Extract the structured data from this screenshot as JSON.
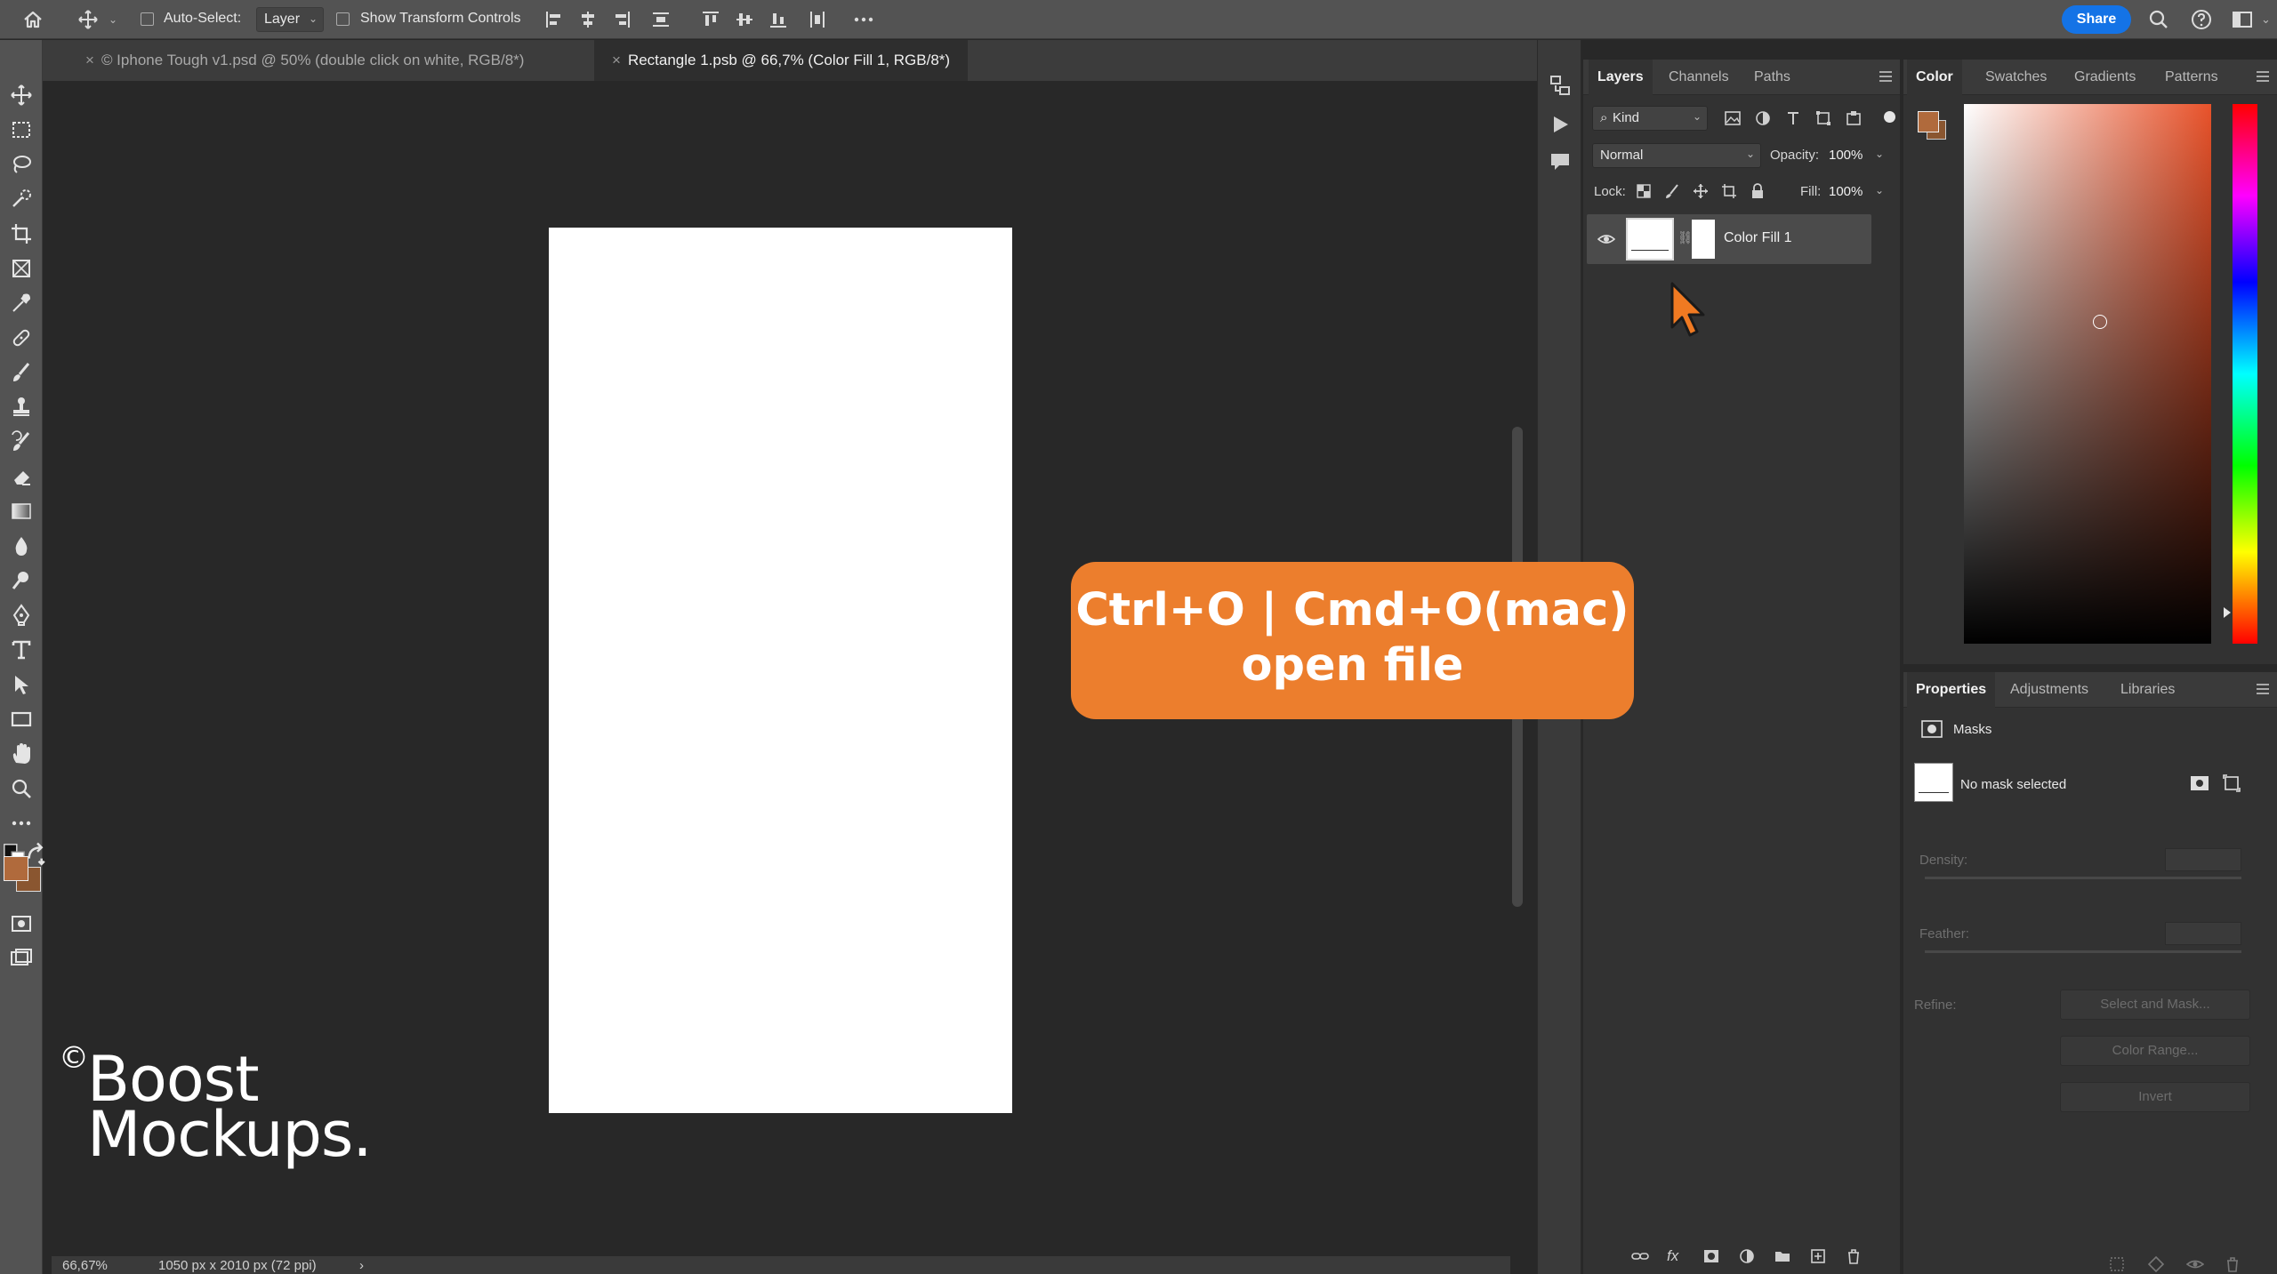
{
  "options_bar": {
    "auto_select_label": "Auto-Select:",
    "auto_select_target": "Layer",
    "show_transform_label": "Show Transform Controls",
    "share_label": "Share"
  },
  "document_tabs": [
    {
      "label": "© Iphone Tough v1.psd @ 50% (double click on white, RGB/8*)",
      "active": false
    },
    {
      "label": "Rectangle 1.psb @ 66,7% (Color Fill 1, RGB/8*)",
      "active": true
    }
  ],
  "layers_panel": {
    "tabs": [
      "Layers",
      "Channels",
      "Paths"
    ],
    "active_tab": "Layers",
    "filter_kind": "Kind",
    "blend_mode": "Normal",
    "opacity_label": "Opacity:",
    "opacity_value": "100%",
    "lock_label": "Lock:",
    "fill_label": "Fill:",
    "fill_value": "100%",
    "layers": [
      {
        "name": "Color Fill 1",
        "visible": true
      }
    ]
  },
  "color_panel": {
    "tabs": [
      "Color",
      "Swatches",
      "Gradients",
      "Patterns"
    ],
    "active_tab": "Color",
    "foreground": "#b06a3c",
    "background": "#8a5630",
    "hue": "#e8522a"
  },
  "properties_panel": {
    "tabs": [
      "Properties",
      "Adjustments",
      "Libraries"
    ],
    "active_tab": "Properties",
    "section": "Masks",
    "mask_status": "No mask selected",
    "density_label": "Density:",
    "feather_label": "Feather:",
    "refine_label": "Refine:",
    "buttons": [
      "Select and Mask...",
      "Color Range...",
      "Invert"
    ]
  },
  "status_bar": {
    "zoom": "66,67%",
    "doc_size": "1050 px x 2010 px (72 ppi)"
  },
  "overlay": {
    "shortcut_line1": "Ctrl+O | Cmd+O(mac)",
    "shortcut_line2": "open file",
    "watermark_symbol": "©",
    "watermark_line1": "Boost",
    "watermark_line2": "Mockups."
  },
  "colors": {
    "accent": "#1473e6",
    "callout": "#ec7e2d",
    "toolbar_fg": "#b06a3c",
    "toolbar_bg": "#8a5630"
  }
}
